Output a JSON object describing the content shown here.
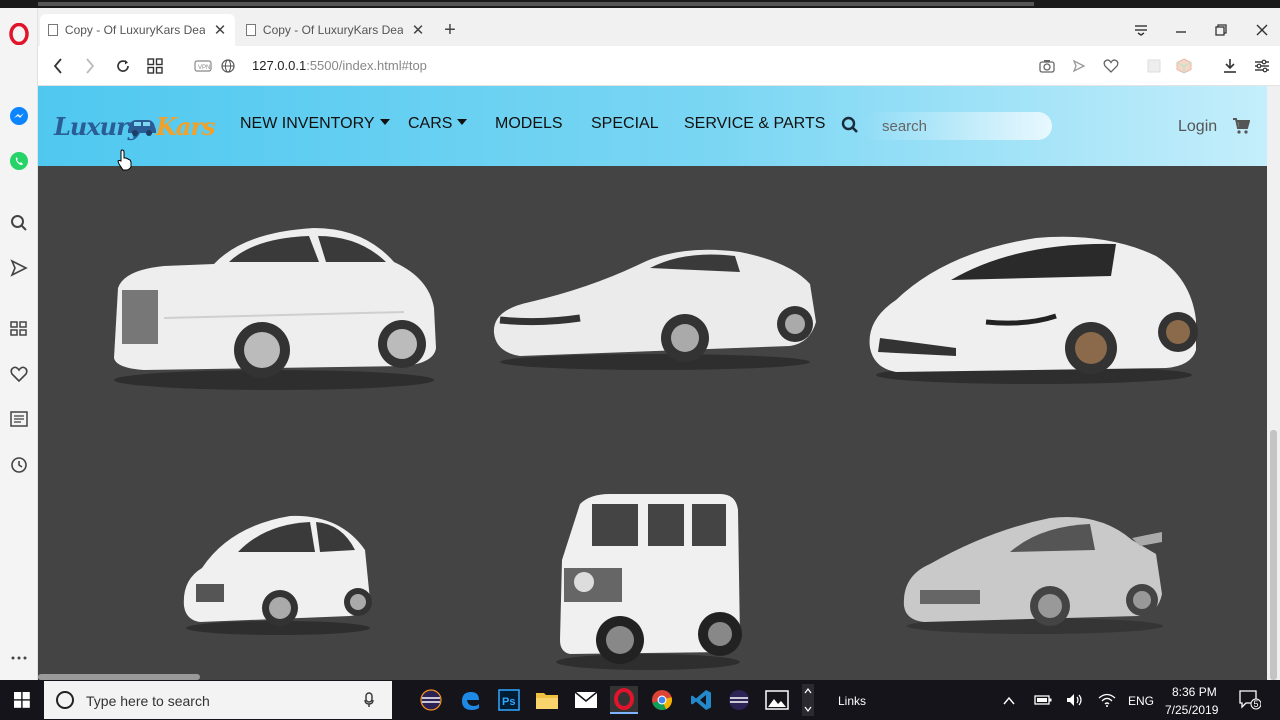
{
  "browser": {
    "tabs": [
      {
        "title": "Copy - Of LuxuryKars Dealer"
      },
      {
        "title": "Copy - Of LuxuryKars Dealer"
      }
    ],
    "url_host": "127.0.0.1",
    "url_rest": ":5500/index.html#top"
  },
  "site": {
    "logo_part1": "Luxury",
    "logo_part2": "Kars",
    "menu": [
      {
        "label": "NEW INVENTORY",
        "dropdown": true
      },
      {
        "label": "CARS",
        "dropdown": true
      },
      {
        "label": "MODELS",
        "dropdown": false
      },
      {
        "label": "SPECIAL",
        "dropdown": false
      },
      {
        "label": "SERVICE & PARTS",
        "dropdown": false
      }
    ],
    "search_placeholder": "search",
    "login_label": "Login"
  },
  "colors": {
    "navbar_start": "#4fc8f0",
    "navbar_end": "#c4eefb",
    "page_bg": "#444444",
    "logo_blue": "#2a5d96",
    "logo_orange": "#f1a12a"
  },
  "taskbar": {
    "search_placeholder": "Type here to search",
    "links_label": "Links",
    "lang": "ENG",
    "time": "8:36 PM",
    "date": "7/25/2019",
    "notification_count": "5"
  }
}
